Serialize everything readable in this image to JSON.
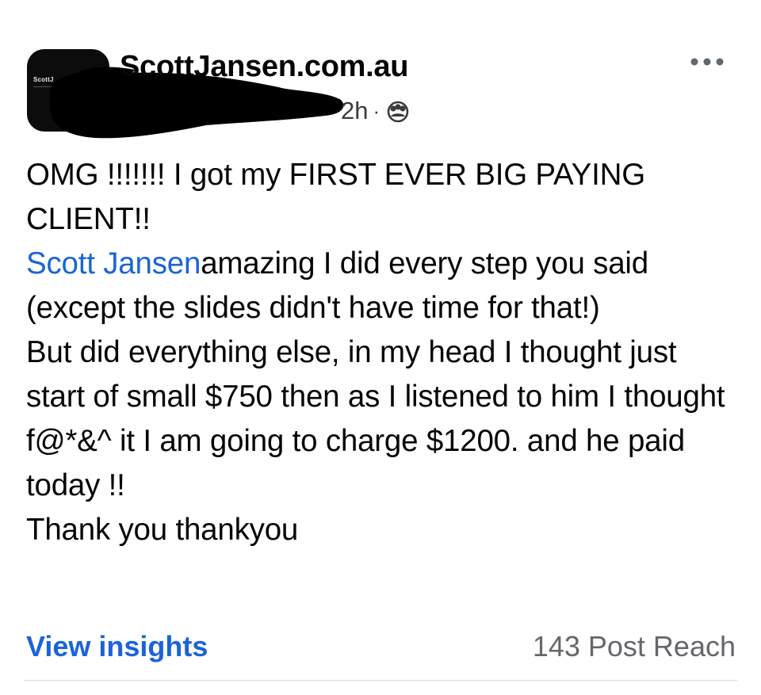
{
  "post": {
    "page_name": "ScottJansen.com.au",
    "avatar_text": "ScottJ",
    "timestamp": "2h",
    "separator": "·",
    "audience_icon": "friends-icon",
    "more_icon": "more-dots-icon",
    "body": {
      "line1": "OMG !!!!!!! I got my FIRST EVER BIG PAYING CLIENT!!",
      "mention": "Scott Jansen",
      "line2_rest": "amazing I did every step you said (except the slides didn't have time for that!)",
      "line3": "But did everything else, in my head I thought just start of small $750 then as I listened to him I thought f@*&^ it I am going to charge $1200. and he paid today !!",
      "line4": "Thank you thankyou"
    }
  },
  "footer": {
    "insights_label": "View insights",
    "reach_label": "143 Post Reach"
  },
  "colors": {
    "link": "#1b64d6",
    "text": "#050505",
    "muted": "#65676b",
    "redaction": "#000000"
  }
}
